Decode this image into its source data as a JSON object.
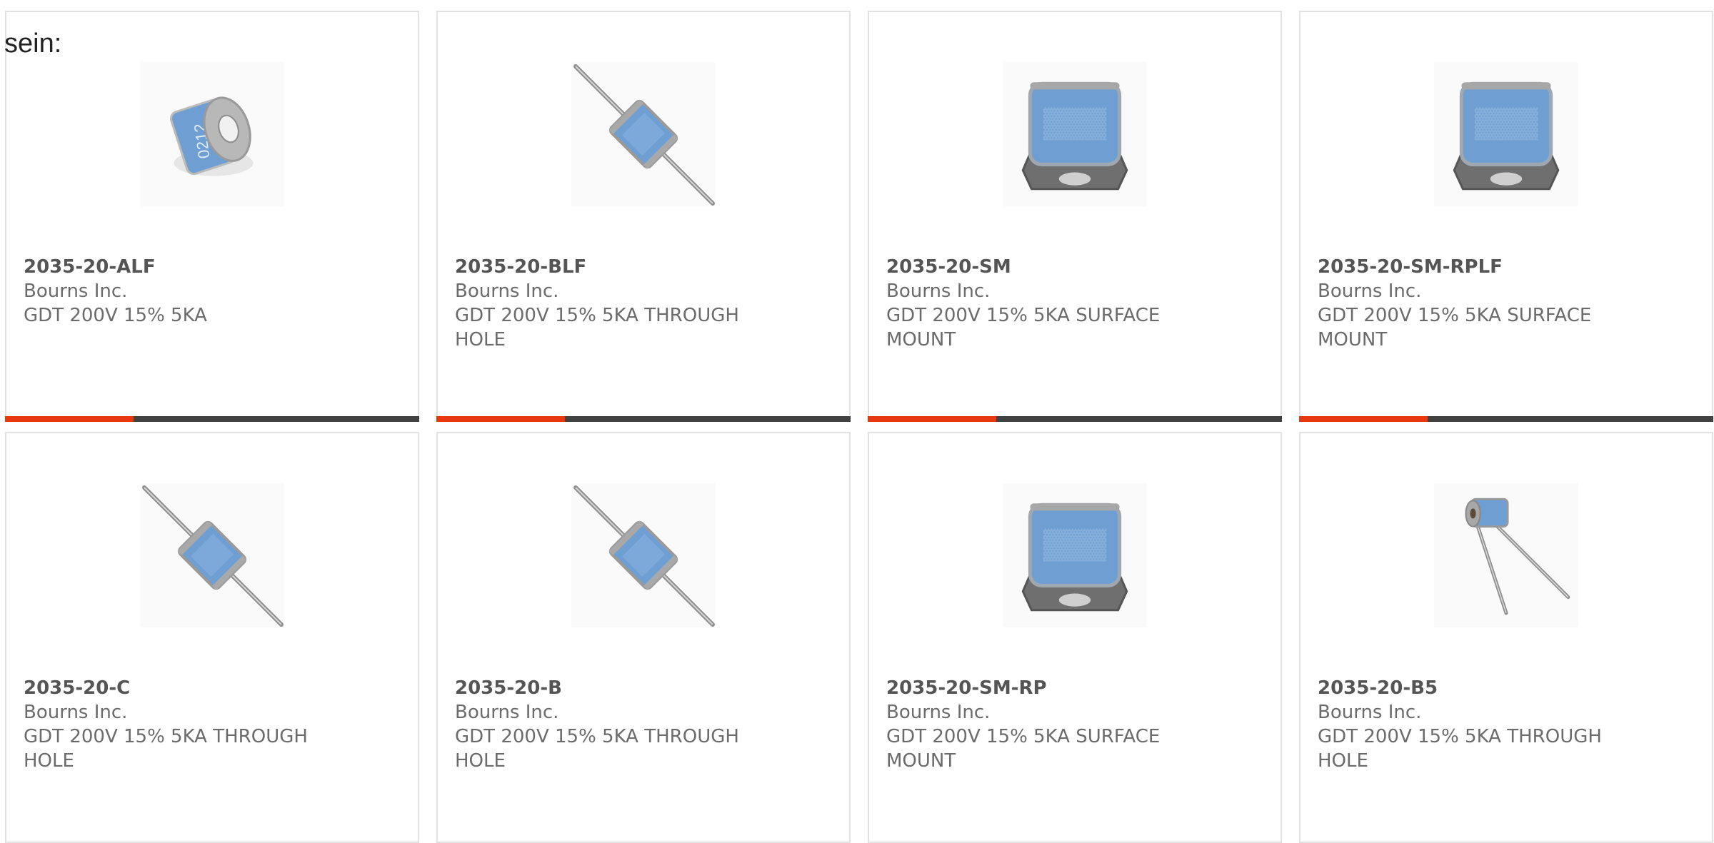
{
  "intro_text": "sein:",
  "products": [
    {
      "part": "2035-20-ALF",
      "maker": "Bourns Inc.",
      "desc": "GDT 200V 15% 5KA",
      "image": "gdt-button-icon",
      "image_text": "0212",
      "progress": 0.31
    },
    {
      "part": "2035-20-BLF",
      "maker": "Bourns Inc.",
      "desc": "GDT 200V 15% 5KA THROUGH HOLE",
      "image": "gdt-axial-lead-icon",
      "progress": 0.31
    },
    {
      "part": "2035-20-SM",
      "maker": "Bourns Inc.",
      "desc": "GDT 200V 15% 5KA SURFACE MOUNT",
      "image": "gdt-surface-mount-icon",
      "progress": 0.31
    },
    {
      "part": "2035-20-SM-RPLF",
      "maker": "Bourns Inc.",
      "desc": "GDT 200V 15% 5KA SURFACE MOUNT",
      "image": "gdt-surface-mount-icon",
      "progress": 0.31
    },
    {
      "part": "2035-20-C",
      "maker": "Bourns Inc.",
      "desc": "GDT 200V 15% 5KA THROUGH HOLE",
      "image": "gdt-axial-lead-icon"
    },
    {
      "part": "2035-20-B",
      "maker": "Bourns Inc.",
      "desc": "GDT 200V 15% 5KA THROUGH HOLE",
      "image": "gdt-axial-lead-icon"
    },
    {
      "part": "2035-20-SM-RP",
      "maker": "Bourns Inc.",
      "desc": "GDT 200V 15% 5KA SURFACE MOUNT",
      "image": "gdt-surface-mount-icon"
    },
    {
      "part": "2035-20-B5",
      "maker": "Bourns Inc.",
      "desc": "GDT 200V 15% 5KA THROUGH HOLE",
      "image": "gdt-radial-lead-icon"
    }
  ],
  "colors": {
    "accent": "#e8380f",
    "bar_track": "#414141",
    "body_blue": "#6f9fd2",
    "metal": "#8e8e8e"
  }
}
